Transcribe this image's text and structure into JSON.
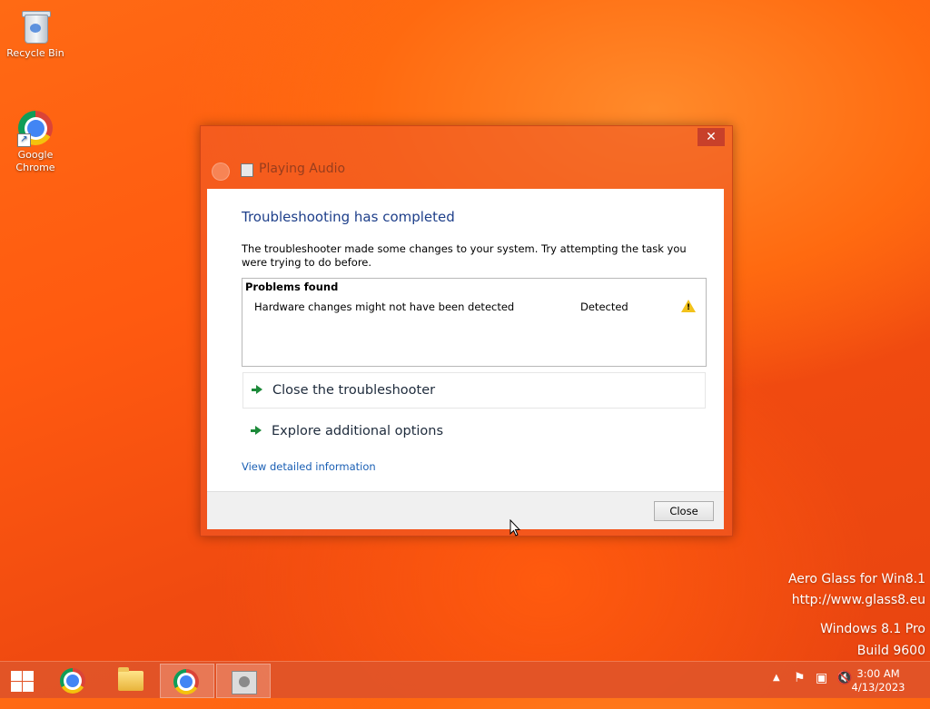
{
  "desktop": {
    "icons": [
      {
        "label": "Recycle Bin",
        "icon": "recycle-bin-icon"
      },
      {
        "label": "Google Chrome",
        "icon": "chrome-icon"
      }
    ]
  },
  "dialog": {
    "window_title": "Playing Audio",
    "close_glyph": "✕",
    "heading": "Troubleshooting has completed",
    "description": "The troubleshooter made some changes to your system. Try attempting the task you were trying to do before.",
    "problems": {
      "header": "Problems found",
      "rows": [
        {
          "name": "Hardware changes might not have been detected",
          "status": "Detected",
          "icon": "warning-icon"
        }
      ]
    },
    "options": [
      {
        "label": "Close the troubleshooter"
      },
      {
        "label": "Explore additional options"
      }
    ],
    "detail_link": "View detailed information",
    "close_button": "Close"
  },
  "watermark": {
    "line1": "Aero Glass for Win8.1",
    "line2": "http://www.glass8.eu",
    "line3": "Windows 8.1 Pro",
    "line4": "Build 9600"
  },
  "taskbar": {
    "apps": [
      "chrome-icon",
      "file-explorer-icon",
      "chrome-icon",
      "troubleshooter-icon"
    ],
    "tray_icons": [
      "show-hidden-icons",
      "action-center-flag-icon",
      "network-icon",
      "volume-muted-icon"
    ],
    "time": "3:00 AM",
    "date": "4/13/2023"
  },
  "colors": {
    "accent_heading": "#1e3f8a",
    "link": "#1a5fb4",
    "taskbar": "#e1552a",
    "desktop": "#ff5a10"
  }
}
